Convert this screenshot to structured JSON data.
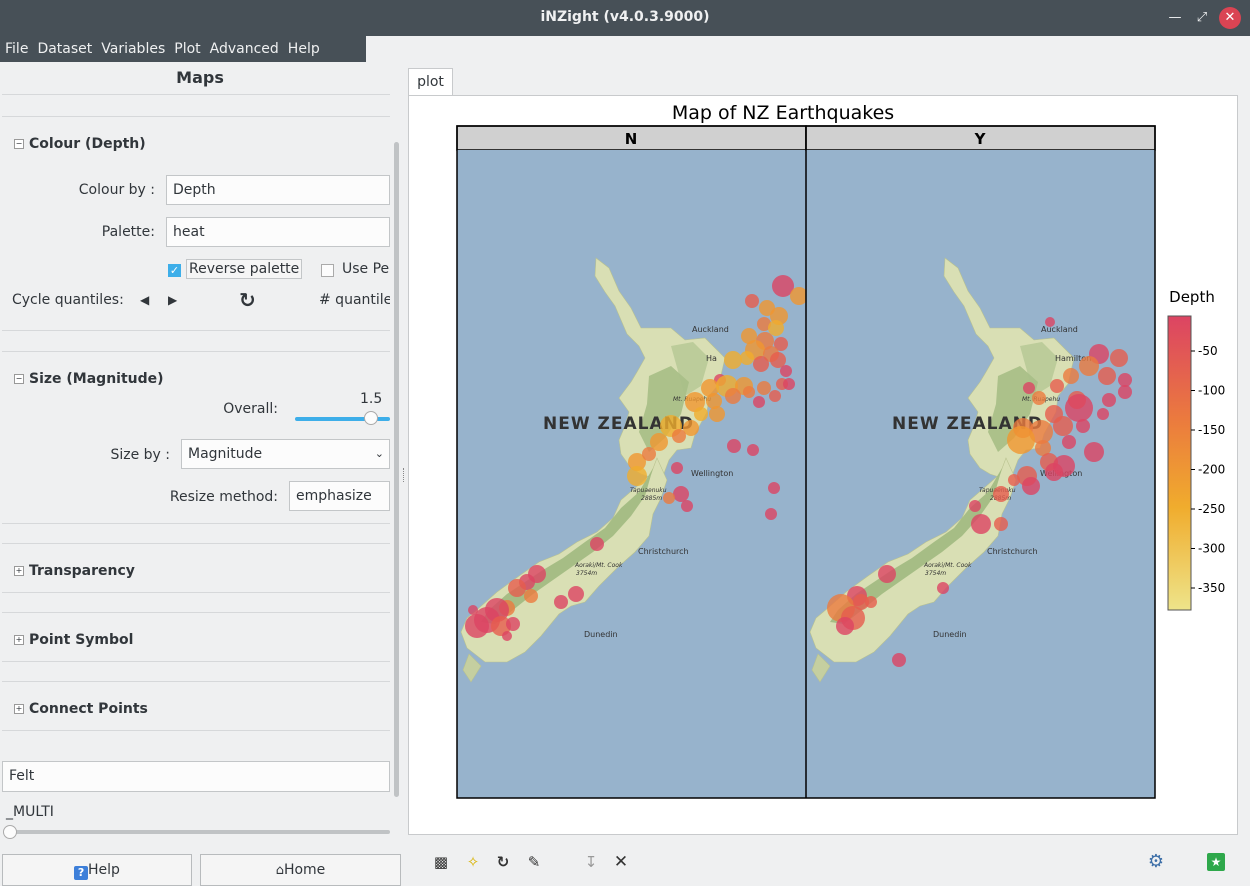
{
  "window": {
    "title": "iNZight (v4.0.3.9000)"
  },
  "menu": [
    "File",
    "Dataset",
    "Variables",
    "Plot",
    "Advanced",
    "Help"
  ],
  "panel": {
    "title": "Maps",
    "colour": {
      "header": "Colour (Depth)",
      "colour_by_label": "Colour by :",
      "colour_by_value": "Depth",
      "palette_label": "Palette:",
      "palette_value": "heat",
      "reverse_label": "Reverse palette",
      "reverse_checked": true,
      "use_label": "Use Pe",
      "use_checked": false,
      "cycle_label": "Cycle quantiles:",
      "quantiles_label": "# quantile"
    },
    "size": {
      "header": "Size (Magnitude)",
      "overall_label": "Overall:",
      "overall_value": "1.5",
      "size_by_label": "Size by :",
      "size_by_value": "Magnitude",
      "resize_label": "Resize method:",
      "resize_value": "emphasize"
    },
    "transparency": {
      "header": "Transparency"
    },
    "point_symbol": {
      "header": "Point Symbol"
    },
    "connect_points": {
      "header": "Connect Points"
    },
    "felt_field": "Felt",
    "multi_label": "_MULTI",
    "help_button": "Help",
    "home_button": "Home"
  },
  "plot_tab": "plot",
  "plot": {
    "title": "Map of NZ Earthquakes",
    "panels": [
      "N",
      "Y"
    ],
    "map_labels": {
      "country": "NEW ZEALAND",
      "auckland": "Auckland",
      "hamilton": "Hamilton",
      "hamilton_short": "Ha",
      "ruapehu": "Mt. Ruapehu",
      "wellington": "Wellington",
      "tapuaenuku": "Tapuaenuku",
      "tapuaenuku_height": "2885m",
      "christchurch": "Christchurch",
      "cook": "Aoraki/Mt. Cook",
      "cook_height": "3754m",
      "dunedin": "Dunedin"
    },
    "legend": {
      "title": "Depth",
      "ticks": [
        "-50",
        "-100",
        "-150",
        "-200",
        "-250",
        "-300",
        "-350"
      ]
    },
    "colors": {
      "ocean": "#97b3cc",
      "land": "#d9dfb4",
      "forest": "#9cb77c",
      "deep": "#f0e68c",
      "shallow": "#dc4463"
    }
  },
  "chart_data": {
    "type": "scatter",
    "title": "Map of NZ Earthquakes",
    "facet": "Felt",
    "facets": [
      "N",
      "Y"
    ],
    "color_by": "Depth",
    "size_by": "Magnitude",
    "color_range": [
      -380,
      -10
    ]
  }
}
